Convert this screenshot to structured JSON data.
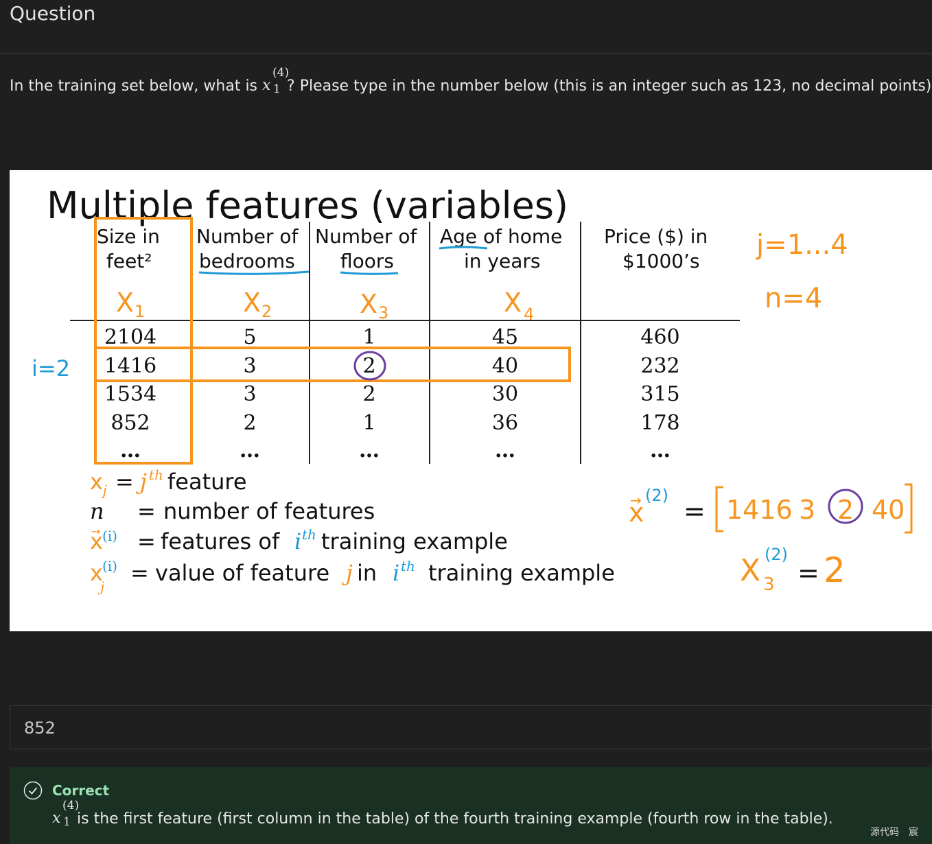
{
  "header": {
    "title": "Question"
  },
  "question": {
    "prefix": "In the training set below, what is",
    "math_base": "x",
    "math_sup": "(4)",
    "math_sub": "1",
    "suffix": "? Please type in the number below (this is an integer such as 123, no decimal points)."
  },
  "figure": {
    "title": "Multiple features (variables)",
    "columns": [
      {
        "line1": "Size in",
        "line2": "feet²",
        "var_letter": "X",
        "var_sub": "1"
      },
      {
        "line1": "Number of",
        "line2": "bedrooms",
        "var_letter": "X",
        "var_sub": "2"
      },
      {
        "line1": "Number of",
        "line2": "floors",
        "var_letter": "X",
        "var_sub": "3"
      },
      {
        "line1": "Age of home",
        "line2": "in years",
        "var_letter": "X",
        "var_sub": "4"
      },
      {
        "line1": "Price ($) in",
        "line2": "$1000’s",
        "var_letter": "",
        "var_sub": ""
      }
    ],
    "rows": [
      [
        "2104",
        "5",
        "1",
        "45",
        "460"
      ],
      [
        "1416",
        "3",
        "2",
        "40",
        "232"
      ],
      [
        "1534",
        "3",
        "2",
        "30",
        "315"
      ],
      [
        "852",
        "2",
        "1",
        "36",
        "178"
      ],
      [
        "…",
        "…",
        "…",
        "…",
        "…"
      ]
    ],
    "row_annotation": "i=2",
    "side_notes": {
      "j_range": "j=1...4",
      "n_value": "n=4"
    },
    "definitions": [
      {
        "symbol": "x",
        "sub": "j",
        "sup": "",
        "eq": "=",
        "text_a": "",
        "italic_j": "j",
        "sup_th": "th",
        "text_b": " feature"
      },
      {
        "symbol": "n",
        "eq": "=",
        "text": "number of features"
      },
      {
        "symbol": "x",
        "sup": "(i)",
        "eq": "=",
        "text_a": "features of ",
        "italic_i": "i",
        "sup_th": "th",
        "text_b": " training example"
      },
      {
        "symbol": "x",
        "sub": "j",
        "sup": "(i)",
        "eq": "=",
        "text_a": "value of feature ",
        "italic_j": "j",
        "text_mid": " in ",
        "italic_i": "i",
        "sup_th": "th",
        "text_b": " training example"
      }
    ],
    "vector_note": {
      "symbol": "x",
      "sup": "(2)",
      "eq": "=",
      "values": [
        "1416",
        "3",
        "2",
        "40"
      ]
    },
    "element_note": {
      "symbol": "X",
      "sub": "3",
      "sup": "(2)",
      "eq": "=",
      "value": "2"
    },
    "colors": {
      "orange": "#f7941d",
      "blue": "#1e9ad6",
      "purple": "#6b3fa0",
      "black": "#111111"
    }
  },
  "answer": {
    "value": "852"
  },
  "feedback": {
    "status": "Correct",
    "math_base": "x",
    "math_sup": "(4)",
    "math_sub": "1",
    "text": "is the first feature (first column in the table) of the fourth training example (fourth row in the table)."
  },
  "watermark": {
    "a": "源代码",
    "b": "宸"
  }
}
